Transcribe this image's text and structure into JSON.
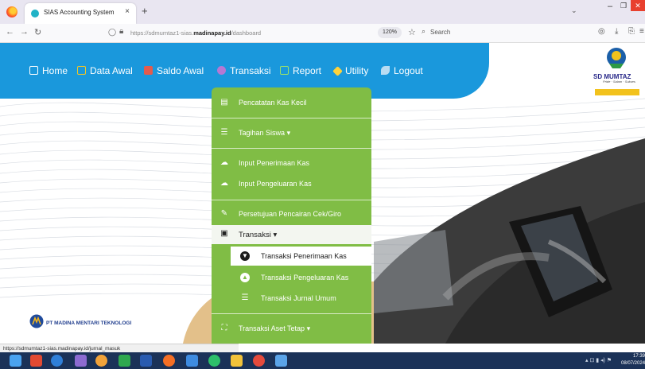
{
  "browser": {
    "tab_title": "SIAS Accounting System",
    "tab_close": "×",
    "new_tab": "+",
    "url_prefix": "https://sdmumtaz1-sias.",
    "url_domain": "madinapay.id",
    "url_path": "/dashboard",
    "zoom": "120%",
    "search_label": "Search",
    "status_url": "https://sdmumtaz1-sias.madinapay.id/jurnal_masuk"
  },
  "nav": {
    "items": [
      {
        "label": "Home",
        "icon": "home-icon",
        "color": "#ffffff"
      },
      {
        "label": "Data Awal",
        "icon": "laptop-icon",
        "color": "#f3c623"
      },
      {
        "label": "Saldo Awal",
        "icon": "money-icon",
        "color": "#e35b4d"
      },
      {
        "label": "Transaksi",
        "icon": "refresh-icon",
        "color": "#b678d3"
      },
      {
        "label": "Report",
        "icon": "monitor-icon",
        "color": "#9be26a"
      },
      {
        "label": "Utility",
        "icon": "tools-icon",
        "color": "#ffd23a"
      },
      {
        "label": "Logout",
        "icon": "logout-icon",
        "color": "#b9dcf2"
      }
    ]
  },
  "dropdown": {
    "items": [
      {
        "label": "Pencatatan Kas Kecil",
        "icon": "document-icon"
      },
      {
        "label": "Tagihan Siswa",
        "icon": "list-icon"
      },
      {
        "label": "Input Penerimaan Kas",
        "icon": "cloud-upload-icon"
      },
      {
        "label": "Input Pengeluaran Kas",
        "icon": "cloud-upload-icon"
      },
      {
        "label": "Persetujuan Pencairan Cek/Giro",
        "icon": "approve-icon"
      }
    ],
    "submenu_header": "Transaksi",
    "submenu_items": [
      {
        "label": "Transaksi Penerimaan Kas",
        "icon": "arrow-circle-down-icon",
        "active": true
      },
      {
        "label": "Transaksi Pengeluaran Kas",
        "icon": "arrow-circle-up-icon",
        "active": false
      },
      {
        "label": "Transaksi Jurnal Umum",
        "icon": "list-icon",
        "active": false
      }
    ],
    "last_item": "Transaksi Aset Tetap",
    "caret": "▾"
  },
  "brand": {
    "name": "SD MUMTAZ",
    "tagline": "Pride · Salam · Sukses"
  },
  "company": "PT MADINA MENTARI TEKNOLOGI",
  "clock": {
    "time": "17:39",
    "date": "08/07/2024"
  },
  "colors": {
    "nav_bg": "#1a98dc",
    "menu_bg": "#80bd45",
    "taskbar": "#1b3258"
  }
}
